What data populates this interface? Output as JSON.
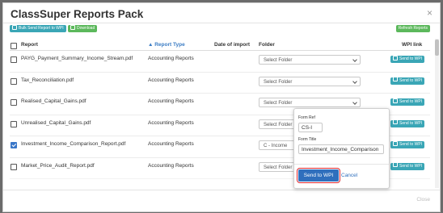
{
  "modal": {
    "title": "ClassSuper Reports Pack",
    "close_icon": "×",
    "footer_close_label": "Close"
  },
  "toolbar": {
    "bulk_send_label": "Bulk Send Report to WPI",
    "download_label": "Download",
    "refresh_label": "Refresh Reports"
  },
  "table": {
    "headers": {
      "report": "Report",
      "report_type": "▲ Report Type",
      "date_of_import": "Date of import",
      "folder": "Folder",
      "wpi_link": "WPI link"
    },
    "send_label": "Send to WPI",
    "rows": [
      {
        "name": "PAYG_Payment_Summary_Income_Stream.pdf",
        "type": "Accounting Reports",
        "folder": "Select Folder",
        "checked": false
      },
      {
        "name": "Tax_Reconciliation.pdf",
        "type": "Accounting Reports",
        "folder": "Select Folder",
        "checked": false
      },
      {
        "name": "Realised_Capital_Gains.pdf",
        "type": "Accounting Reports",
        "folder": "Select Folder",
        "checked": false
      },
      {
        "name": "Unrealised_Capital_Gains.pdf",
        "type": "Accounting Reports",
        "folder": "Select Folder",
        "checked": false
      },
      {
        "name": "Investment_Income_Comparison_Report.pdf",
        "type": "Accounting Reports",
        "folder": "C - Income",
        "checked": true
      },
      {
        "name": "Market_Price_Audit_Report.pdf",
        "type": "Accounting Reports",
        "folder": "Select Folder",
        "checked": false
      }
    ]
  },
  "popover": {
    "form_ref_label": "Form Ref",
    "form_ref_value": "CS-I",
    "form_title_label": "Form Title",
    "form_title_value": "Investment_Income_Comparison",
    "send_button": "Send to WPI",
    "cancel_link": "Cancel"
  },
  "colors": {
    "primary": "#2f6fbd",
    "teal": "#3aa6b6",
    "green": "#5cb85c",
    "highlight": "#e0262b"
  },
  "icons": [
    "close-icon",
    "send-icon",
    "download-icon",
    "refresh-icon",
    "chevron-down-icon",
    "checkbox-icon"
  ]
}
